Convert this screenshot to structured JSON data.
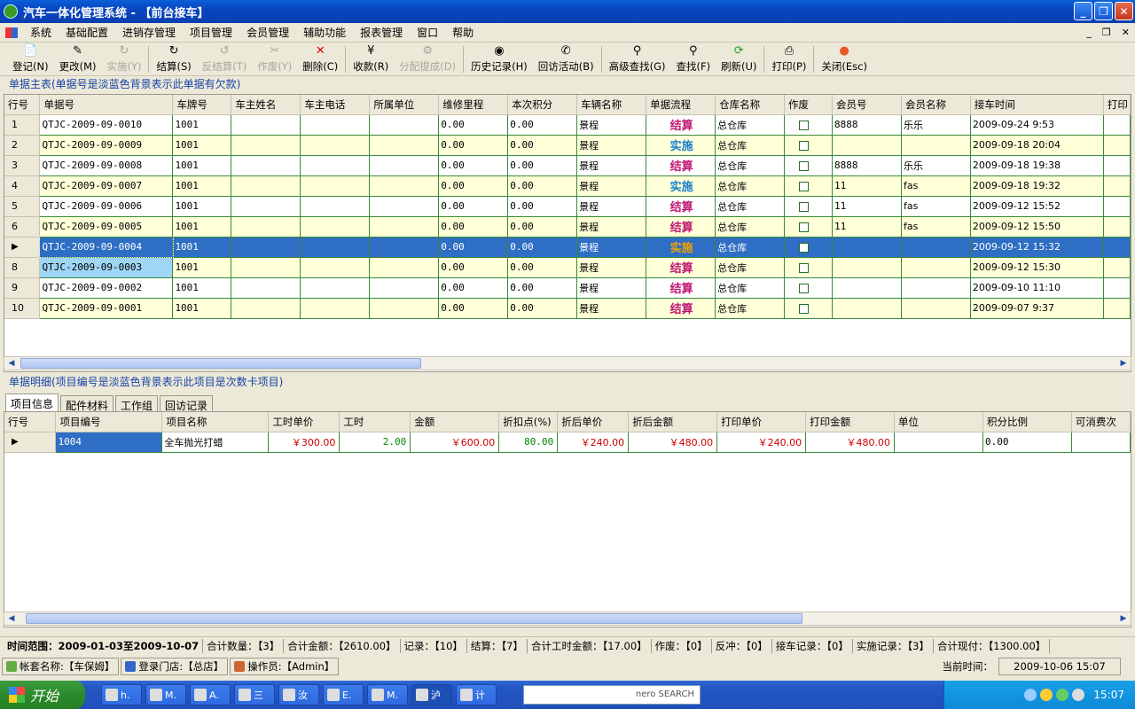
{
  "window": {
    "title": "汽车一体化管理系统 - 【前台接车】"
  },
  "menu": [
    "系统",
    "基础配置",
    "进销存管理",
    "项目管理",
    "会员管理",
    "辅助功能",
    "报表管理",
    "窗口",
    "帮助"
  ],
  "toolbar": [
    {
      "label": "登记(N)",
      "icon": "new-document-icon",
      "enabled": true
    },
    {
      "label": "更改(M)",
      "icon": "edit-icon",
      "enabled": true
    },
    {
      "label": "实施(Y)",
      "icon": "implement-icon",
      "enabled": false
    },
    {
      "label": "结算(S)",
      "icon": "settle-icon",
      "enabled": true
    },
    {
      "label": "反结算(T)",
      "icon": "unsettle-icon",
      "enabled": false
    },
    {
      "label": "作废(Y)",
      "icon": "void-icon",
      "enabled": false
    },
    {
      "label": "删除(C)",
      "icon": "delete-icon",
      "enabled": true
    },
    {
      "label": "收款(R)",
      "icon": "payment-icon",
      "enabled": true
    },
    {
      "label": "分配提成(D)",
      "icon": "commission-icon",
      "enabled": false
    },
    {
      "label": "历史记录(H)",
      "icon": "history-icon",
      "enabled": true
    },
    {
      "label": "回访活动(B)",
      "icon": "follow-up-icon",
      "enabled": true
    },
    {
      "label": "高级查找(G)",
      "icon": "advanced-search-icon",
      "enabled": true
    },
    {
      "label": "查找(F)",
      "icon": "search-icon",
      "enabled": true
    },
    {
      "label": "刷新(U)",
      "icon": "refresh-icon",
      "enabled": true
    },
    {
      "label": "打印(P)",
      "icon": "print-icon",
      "enabled": true
    },
    {
      "label": "关闭(Esc)",
      "icon": "close-icon",
      "enabled": true
    }
  ],
  "main_section": {
    "title": "单据主表(单据号是淡蓝色背景表示此单据有欠款)"
  },
  "main_table": {
    "columns": [
      "行号",
      "单据号",
      "车牌号",
      "车主姓名",
      "车主电话",
      "所属单位",
      "维修里程",
      "本次积分",
      "车辆名称",
      "单据流程",
      "仓库名称",
      "作废",
      "会员号",
      "会员名称",
      "接车时间",
      "打印"
    ],
    "rows": [
      {
        "n": "1",
        "no": "QTJC-2009-09-0010",
        "plate": "1001",
        "owner": "",
        "phone": "",
        "unit": "",
        "mileage": "0.00",
        "points": "0.00",
        "car": "景程",
        "flow": "结算",
        "wh": "总仓库",
        "mem": "8888",
        "memname": "乐乐",
        "time": "2009-09-24 9:53"
      },
      {
        "n": "2",
        "no": "QTJC-2009-09-0009",
        "plate": "1001",
        "owner": "",
        "phone": "",
        "unit": "",
        "mileage": "0.00",
        "points": "0.00",
        "car": "景程",
        "flow": "实施",
        "wh": "总仓库",
        "mem": "",
        "memname": "",
        "time": "2009-09-18 20:04"
      },
      {
        "n": "3",
        "no": "QTJC-2009-09-0008",
        "plate": "1001",
        "owner": "",
        "phone": "",
        "unit": "",
        "mileage": "0.00",
        "points": "0.00",
        "car": "景程",
        "flow": "结算",
        "wh": "总仓库",
        "mem": "8888",
        "memname": "乐乐",
        "time": "2009-09-18 19:38"
      },
      {
        "n": "4",
        "no": "QTJC-2009-09-0007",
        "plate": "1001",
        "owner": "",
        "phone": "",
        "unit": "",
        "mileage": "0.00",
        "points": "0.00",
        "car": "景程",
        "flow": "实施",
        "wh": "总仓库",
        "mem": "11",
        "memname": "fas",
        "time": "2009-09-18 19:32"
      },
      {
        "n": "5",
        "no": "QTJC-2009-09-0006",
        "plate": "1001",
        "owner": "",
        "phone": "",
        "unit": "",
        "mileage": "0.00",
        "points": "0.00",
        "car": "景程",
        "flow": "结算",
        "wh": "总仓库",
        "mem": "11",
        "memname": "fas",
        "time": "2009-09-12 15:52"
      },
      {
        "n": "6",
        "no": "QTJC-2009-09-0005",
        "plate": "1001",
        "owner": "",
        "phone": "",
        "unit": "",
        "mileage": "0.00",
        "points": "0.00",
        "car": "景程",
        "flow": "结算",
        "wh": "总仓库",
        "mem": "11",
        "memname": "fas",
        "time": "2009-09-12 15:50"
      },
      {
        "n": "7",
        "no": "QTJC-2009-09-0004",
        "plate": "1001",
        "owner": "",
        "phone": "",
        "unit": "",
        "mileage": "0.00",
        "points": "0.00",
        "car": "景程",
        "flow": "实施",
        "wh": "总仓库",
        "mem": "",
        "memname": "",
        "time": "2009-09-12 15:32"
      },
      {
        "n": "8",
        "no": "QTJC-2009-09-0003",
        "plate": "1001",
        "owner": "",
        "phone": "",
        "unit": "",
        "mileage": "0.00",
        "points": "0.00",
        "car": "景程",
        "flow": "结算",
        "wh": "总仓库",
        "mem": "",
        "memname": "",
        "time": "2009-09-12 15:30"
      },
      {
        "n": "9",
        "no": "QTJC-2009-09-0002",
        "plate": "1001",
        "owner": "",
        "phone": "",
        "unit": "",
        "mileage": "0.00",
        "points": "0.00",
        "car": "景程",
        "flow": "结算",
        "wh": "总仓库",
        "mem": "",
        "memname": "",
        "time": "2009-09-10 11:10"
      },
      {
        "n": "10",
        "no": "QTJC-2009-09-0001",
        "plate": "1001",
        "owner": "",
        "phone": "",
        "unit": "",
        "mileage": "0.00",
        "points": "0.00",
        "car": "景程",
        "flow": "结算",
        "wh": "总仓库",
        "mem": "",
        "memname": "",
        "time": "2009-09-07 9:37"
      }
    ],
    "selected_row": 7,
    "owing_row": 8
  },
  "detail_section": {
    "title": "单据明细(项目编号是淡蓝色背景表示此项目是次数卡项目)"
  },
  "detail_tabs": [
    "项目信息",
    "配件材料",
    "工作组",
    "回访记录"
  ],
  "detail_table": {
    "columns": [
      "行号",
      "项目编号",
      "项目名称",
      "工时单价",
      "工时",
      "金额",
      "折扣点(%)",
      "折后单价",
      "折后金额",
      "打印单价",
      "打印金额",
      "单位",
      "积分比例",
      "可消费次"
    ],
    "rows": [
      {
        "code": "1004",
        "name": "全车抛光打蜡",
        "rate": "￥300.00",
        "hours": "2.00",
        "amount": "￥600.00",
        "discount": "80.00",
        "disc_price": "￥240.00",
        "disc_amount": "￥480.00",
        "print_price": "￥240.00",
        "print_amount": "￥480.00",
        "unit": "",
        "points_ratio": "0.00",
        "times": ""
      }
    ]
  },
  "summary": [
    "时间范围：2009-01-03至2009-10-07",
    "合计数量：【3】",
    "合计金额：【2610.00】",
    "记录：【10】",
    "结算：【7】",
    "合计工时金额：【17.00】",
    "作废：【0】",
    "反冲：【0】",
    "接车记录：【0】",
    "实施记录：【3】",
    "合计现付：【1300.00】"
  ],
  "status": {
    "account": "帐套名称:【车保姆】",
    "store": "登录门店:【总店】",
    "operator": "操作员:【Admin】",
    "time_label": "当前时间：",
    "time_value": "2009-10-06 15:07"
  },
  "taskbar": {
    "start": "开始",
    "tasks": [
      "h.",
      "M.",
      "A.",
      "三",
      "汝",
      "E.",
      "M.",
      "泸",
      "计"
    ],
    "search_brand": "nero SEARCH",
    "clock": "15:07"
  },
  "colors": {
    "titlebar": "#0845c0",
    "selected_row": "#2e6ec4",
    "grid_line": "#3a8a3a",
    "row_alt": "#ffffd8",
    "flow_settled": "#c01875",
    "flow_implement": "#1a7fd0",
    "owing_bg": "#9fd6f5"
  }
}
